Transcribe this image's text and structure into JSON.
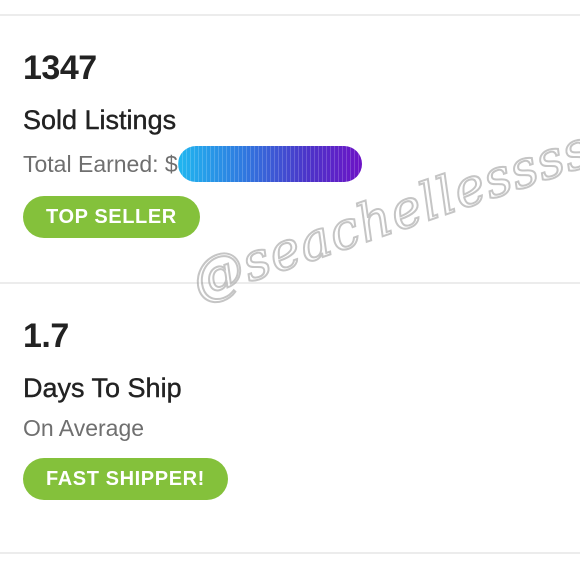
{
  "sold": {
    "count": "1347",
    "title": "Sold Listings",
    "subtitle_prefix": "Total Earned: $",
    "badge": "TOP SELLER"
  },
  "shipping": {
    "value": "1.7",
    "title": "Days To Ship",
    "subtitle": "On Average",
    "badge": "FAST SHIPPER!"
  },
  "watermark": "@seachellessss",
  "colors": {
    "badge_green": "#84c13b",
    "text_dark": "#222222",
    "text_muted": "#6f6f6f",
    "redaction_gradient_start": "#20b7f0",
    "redaction_gradient_end": "#6d13c6"
  }
}
